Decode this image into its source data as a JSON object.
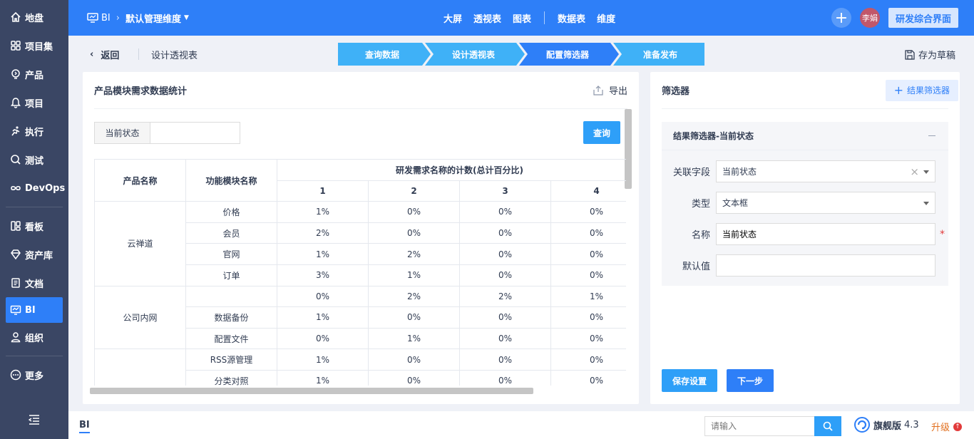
{
  "sidebar": {
    "items": [
      {
        "label": "地盘",
        "icon": "home-icon"
      },
      {
        "label": "项目集",
        "icon": "grid-icon"
      },
      {
        "label": "产品",
        "icon": "lightbulb-icon"
      },
      {
        "label": "项目",
        "icon": "bell-icon"
      },
      {
        "label": "执行",
        "icon": "run-icon"
      },
      {
        "label": "测试",
        "icon": "search-bug-icon"
      },
      {
        "label": "DevOps",
        "icon": "infinity-icon"
      },
      {
        "label": "看板",
        "icon": "kanban-icon"
      },
      {
        "label": "资产库",
        "icon": "diamond-icon"
      },
      {
        "label": "文档",
        "icon": "doc-icon"
      },
      {
        "label": "BI",
        "icon": "monitor-icon"
      },
      {
        "label": "组织",
        "icon": "user-icon"
      },
      {
        "label": "更多",
        "icon": "more-icon"
      }
    ],
    "active": "BI"
  },
  "topbar": {
    "app": "BI",
    "dimension": "默认管理维度",
    "nav": [
      "大屏",
      "透视表",
      "图表",
      "数据表",
      "维度"
    ],
    "active_nav": "透视表",
    "user": "李娟",
    "workspace": "研发综合界面"
  },
  "subheader": {
    "back": "返回",
    "title": "设计透视表",
    "steps": [
      "查询数据",
      "设计透视表",
      "配置筛选器",
      "准备发布"
    ],
    "active_step": "配置筛选器",
    "save_draft": "存为草稿"
  },
  "pivot": {
    "title": "产品模块需求数据统计",
    "export": "导出",
    "filter_label": "当前状态",
    "filter_value": "",
    "query": "查询",
    "headers": {
      "product": "产品名称",
      "module": "功能模块名称",
      "group": "研发需求名称的计数(总计百分比)",
      "cols": [
        "1",
        "2",
        "3",
        "4"
      ]
    },
    "groups": [
      {
        "product": "云禅道",
        "rows": [
          {
            "module": "价格",
            "values": [
              "1%",
              "0%",
              "0%",
              "0%"
            ]
          },
          {
            "module": "会员",
            "values": [
              "2%",
              "0%",
              "0%",
              "0%"
            ]
          },
          {
            "module": "官网",
            "values": [
              "1%",
              "2%",
              "0%",
              "0%"
            ]
          },
          {
            "module": "订单",
            "values": [
              "3%",
              "1%",
              "0%",
              "0%"
            ]
          }
        ]
      },
      {
        "product": "公司内网",
        "rows": [
          {
            "module": "",
            "values": [
              "0%",
              "2%",
              "2%",
              "1%"
            ]
          },
          {
            "module": "数据备份",
            "values": [
              "1%",
              "0%",
              "0%",
              "0%"
            ]
          },
          {
            "module": "配置文件",
            "values": [
              "0%",
              "1%",
              "0%",
              "0%"
            ]
          }
        ]
      },
      {
        "product": "",
        "rows": [
          {
            "module": "RSS源管理",
            "values": [
              "1%",
              "0%",
              "0%",
              "0%"
            ]
          },
          {
            "module": "分类对照",
            "values": [
              "1%",
              "0%",
              "0%",
              "0%"
            ]
          }
        ]
      }
    ]
  },
  "filters_panel": {
    "title": "筛选器",
    "add_button": "结果筛选器",
    "card_title": "结果筛选器-当前状态",
    "field_label": "关联字段",
    "field_value": "当前状态",
    "type_label": "类型",
    "type_value": "文本框",
    "name_label": "名称",
    "name_value": "当前状态",
    "default_label": "默认值",
    "default_value": "",
    "required_mark": "*",
    "save": "保存设置",
    "next": "下一步"
  },
  "bottombar": {
    "tab": "BI",
    "search_placeholder": "请输入",
    "edition": "旗舰版",
    "version": "4.3",
    "upgrade": "升级"
  },
  "colors": {
    "primary": "#2e7ff8",
    "sidebar": "#3a4664",
    "step": "#3fb1f7",
    "accent": "#2e9ff8"
  }
}
